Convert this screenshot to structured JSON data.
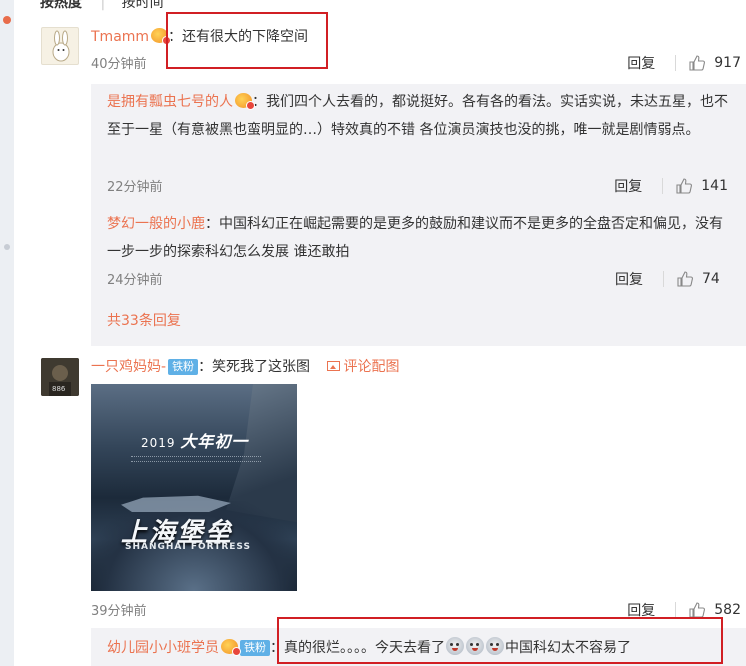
{
  "sort": {
    "by_hot": "按热度",
    "by_time": "按时间"
  },
  "comments": [
    {
      "user": "Tmamm",
      "text": "：还有很大的下降空间",
      "time": "40分钟前",
      "reply_label": "回复",
      "likes": "917",
      "replies": [
        {
          "user": "是拥有瓢虫七号的人",
          "text": "：我们四个人去看的，都说挺好。各有各的看法。实话实说，未达五星，也不至于一星（有意被黑也蛮明显的…）特效真的不错 各位演员演技也没的挑，唯一就是剧情弱点。",
          "time": "22分钟前",
          "reply_label": "回复",
          "likes": "141"
        },
        {
          "user": "梦幻一般的小鹿",
          "text": "：中国科幻正在崛起需要的是更多的鼓励和建议而不是更多的全盘否定和偏见，没有一步一步的探索科幻怎么发展 谁还敢拍",
          "time": "24分钟前",
          "reply_label": "回复",
          "likes": "74"
        }
      ],
      "more_replies": "共33条回复"
    },
    {
      "user": "一只鸡妈妈-",
      "badge": "铁粉",
      "text": "：笑死我了这张图",
      "pic_link": "评论配图",
      "poster": {
        "year": "2019",
        "release": "大年初一",
        "title_cn": "上海堡垒",
        "title_en": "SHANGHAI FORTRESS",
        "avatar_tag": "886"
      },
      "time": "39分钟前",
      "reply_label": "回复",
      "likes": "582",
      "reply_preview": {
        "user": "幼儿园小小班学员",
        "badge": "铁粉",
        "text_before": "：真的很烂。。。。今天去看了",
        "text_after": "中国科幻太不容易了"
      }
    }
  ],
  "colors": {
    "username": "#eb7350",
    "highlight": "#d11f24",
    "reply_bg": "#f2f2f5"
  },
  "icons": [
    "thumbs-up-icon",
    "vip-crown-icon",
    "picture-icon",
    "emoji-icon"
  ]
}
